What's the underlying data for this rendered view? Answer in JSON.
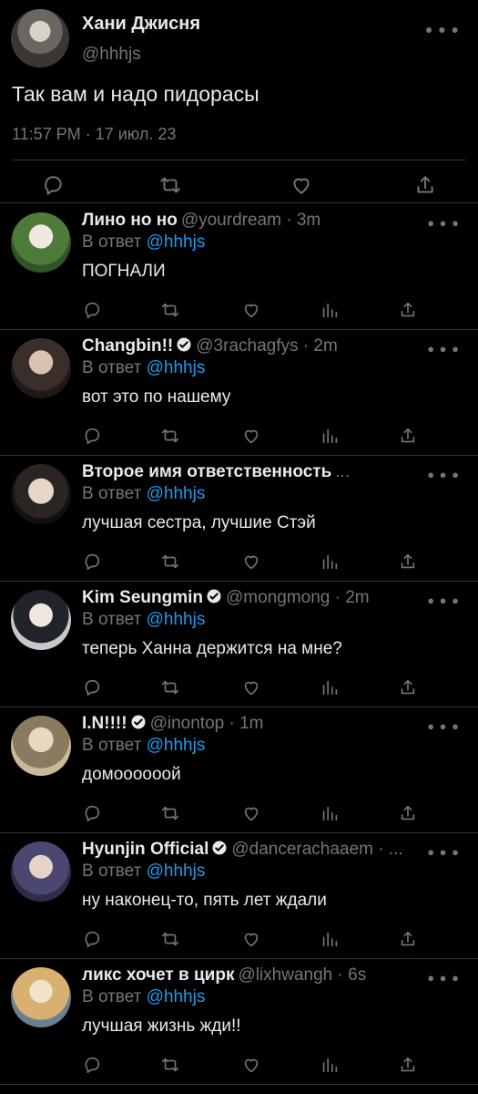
{
  "main_tweet": {
    "name": "Хани Джисня",
    "handle": "@hhhjs",
    "text": "Так вам и надо пидорасы",
    "time": "11:57 PM · 17 июл. 23"
  },
  "replies": [
    {
      "name": "Лино но но",
      "meta": "@yourdream · 3m",
      "reply_label": "В ответ",
      "mention": "@hhhjs",
      "text": "ПОГНАЛИ",
      "verified": false
    },
    {
      "name": "Changbin!!",
      "meta": "@3rachagfys · 2m",
      "reply_label": "В ответ",
      "mention": "@hhhjs",
      "text": "вот это по нашему",
      "verified": true
    },
    {
      "name": "Второе имя ответственность",
      "meta": "...",
      "reply_label": "В ответ",
      "mention": "@hhhjs",
      "text": "лучшая сестра, лучшие Стэй",
      "verified": false
    },
    {
      "name": "Kim Seungmin",
      "meta": "@mongmong · 2m",
      "reply_label": "В ответ",
      "mention": "@hhhjs",
      "text": "теперь Ханна держится на мне?",
      "verified": true
    },
    {
      "name": "I.N!!!!",
      "meta": "@inontop · 1m",
      "reply_label": "В ответ",
      "mention": "@hhhjs",
      "text": "домоооооой",
      "verified": true
    },
    {
      "name": "Hyunjin Official",
      "meta": "@dancerachaaem · ...",
      "reply_label": "В ответ",
      "mention": "@hhhjs",
      "text": "ну наконец-то, пять лет ждали",
      "verified": true
    },
    {
      "name": "ликс хочет в цирк",
      "meta": "@lixhwangh · 6s",
      "reply_label": "В ответ",
      "mention": "@hhhjs",
      "text": "лучшая жизнь жди!!",
      "verified": false
    }
  ],
  "colors": {
    "background": "#000000",
    "text": "#e7e9ea",
    "muted": "#71767b",
    "link": "#1d9bf0",
    "divider": "#2f3336"
  },
  "icons": [
    "reply-icon",
    "retweet-icon",
    "like-icon",
    "views-icon",
    "share-icon",
    "more-icon",
    "verified-icon"
  ]
}
